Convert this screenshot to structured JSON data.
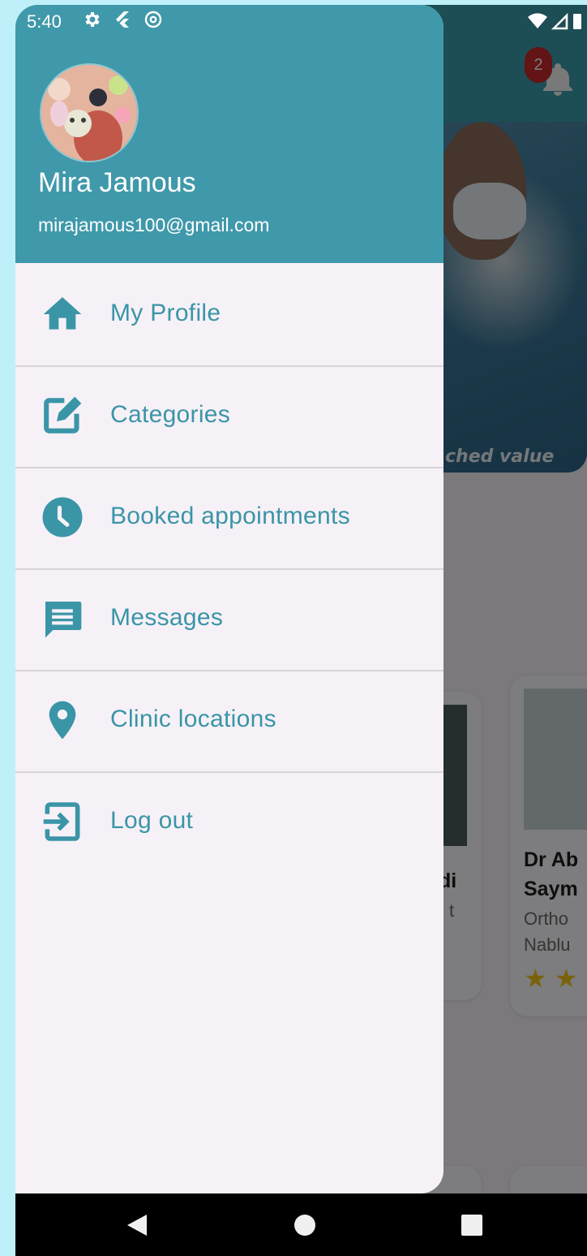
{
  "status_bar": {
    "time": "5:40"
  },
  "drawer": {
    "user": {
      "name": "Mira Jamous",
      "email": "mirajamous100@gmail.com"
    },
    "items": [
      {
        "label": "My Profile",
        "icon": "home-icon"
      },
      {
        "label": "Categories",
        "icon": "edit-icon"
      },
      {
        "label": "Booked appointments",
        "icon": "clock-icon"
      },
      {
        "label": "Messages",
        "icon": "message-icon"
      },
      {
        "label": "Clinic locations",
        "icon": "location-pin-icon"
      },
      {
        "label": "Log out",
        "icon": "logout-icon"
      }
    ]
  },
  "background_app": {
    "notification_count": "2",
    "hero_caption": "ched value",
    "doctor_cards": [
      {
        "name_line1": "",
        "name_line2": "di",
        "specialty": "t",
        "city": ""
      },
      {
        "name_line1": "Dr Ab",
        "name_line2": "Saym",
        "specialty": "Ortho",
        "city": "Nablu"
      }
    ]
  },
  "colors": {
    "accent": "#3f99aa",
    "drawer_background": "#f6f1f7",
    "label": "#3a95a7",
    "badge": "#c62828",
    "star": "#f5c518"
  }
}
